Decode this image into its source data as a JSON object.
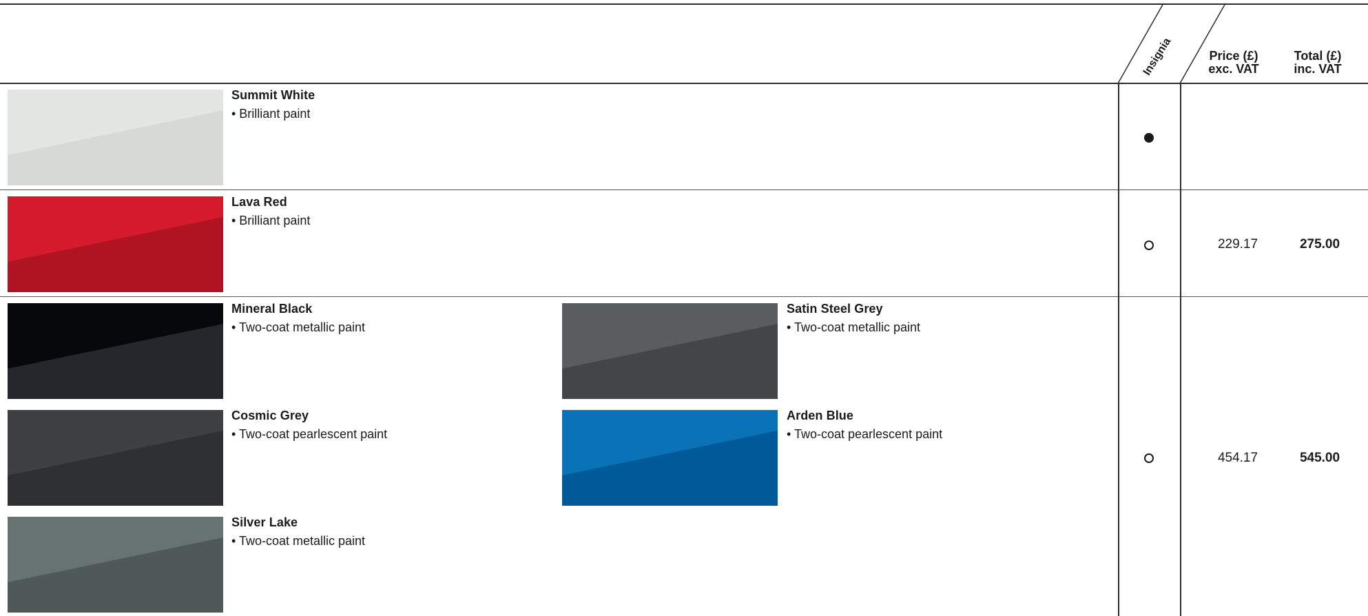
{
  "header": {
    "insignia_label": "Insignia",
    "price_line1": "Price (£)",
    "price_line2": "exc. VAT",
    "total_line1": "Total (£)",
    "total_line2": "inc. VAT"
  },
  "paints": [
    {
      "name": "Summit White",
      "type": "• Brilliant paint",
      "color_top": "#e2e7e4",
      "color_bottom": "#d5dad7"
    },
    {
      "name": "Lava Red",
      "type": "• Brilliant paint",
      "color_top": "#d41a2b",
      "color_bottom": "#b01423"
    },
    {
      "name": "Mineral Black",
      "type": "• Two-coat metallic paint",
      "color_top": "#06080b",
      "color_bottom": "#24272b"
    },
    {
      "name": "Satin Steel Grey",
      "type": "• Two-coat metallic paint",
      "color_top": "#5a5d60",
      "color_bottom": "#434547"
    },
    {
      "name": "Cosmic Grey",
      "type": "• Two-coat pearlescent paint",
      "color_top": "#3e4043",
      "color_bottom": "#2e3033"
    },
    {
      "name": "Arden Blue",
      "type": "• Two-coat pearlescent paint",
      "color_top": "#0a73b8",
      "color_bottom": "#005a99"
    },
    {
      "name": "Silver Lake",
      "type": "• Two-coat metallic paint",
      "color_top": "#677371",
      "color_bottom": "#4f5958"
    }
  ],
  "rows": [
    {
      "insignia": "standard",
      "price": "",
      "total": ""
    },
    {
      "insignia": "option",
      "price": "229.17",
      "total": "275.00"
    },
    {
      "insignia": "option",
      "price": "454.17",
      "total": "545.00"
    }
  ]
}
